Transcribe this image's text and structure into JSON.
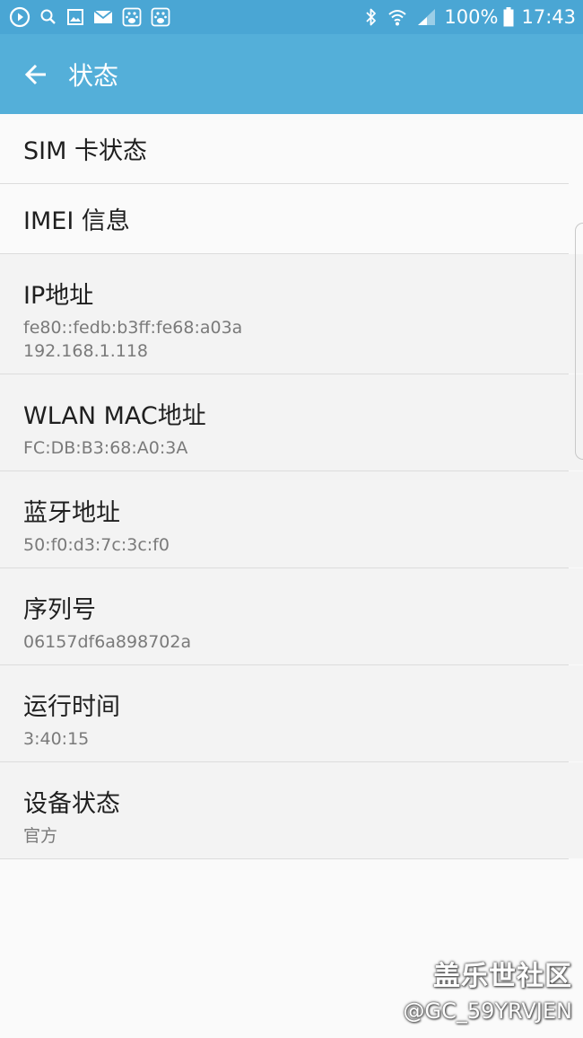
{
  "status_bar": {
    "left_icons": [
      "play-icon",
      "search-icon",
      "image-icon",
      "mail-icon",
      "baidu-icon",
      "baidu-icon"
    ],
    "right_icons": [
      "bluetooth-icon",
      "wifi-icon",
      "signal-icon"
    ],
    "battery": "100%",
    "time": "17:43"
  },
  "app_bar": {
    "title": "状态",
    "back_icon": "arrow-back-icon"
  },
  "items": [
    {
      "label": "SIM 卡状态"
    },
    {
      "label": "IMEI 信息"
    },
    {
      "label": "IP地址",
      "values": [
        "fe80::fedb:b3ff:fe68:a03a",
        "192.168.1.118"
      ]
    },
    {
      "label": "WLAN MAC地址",
      "values": [
        "FC:DB:B3:68:A0:3A"
      ]
    },
    {
      "label": "蓝牙地址",
      "values": [
        "50:f0:d3:7c:3c:f0"
      ]
    },
    {
      "label": "序列号",
      "values": [
        "06157df6a898702a"
      ]
    },
    {
      "label": "运行时间",
      "values": [
        "3:40:15"
      ]
    },
    {
      "label": "设备状态",
      "values": [
        "官方"
      ]
    }
  ],
  "watermark": {
    "line1": "盖乐世社区",
    "line2": "@GC_59YRVJEN"
  },
  "colors": {
    "status_bar": "#4aa6d4",
    "app_bar": "#54afd9",
    "background": "#fafafa",
    "info_row": "#f3f3f3"
  }
}
